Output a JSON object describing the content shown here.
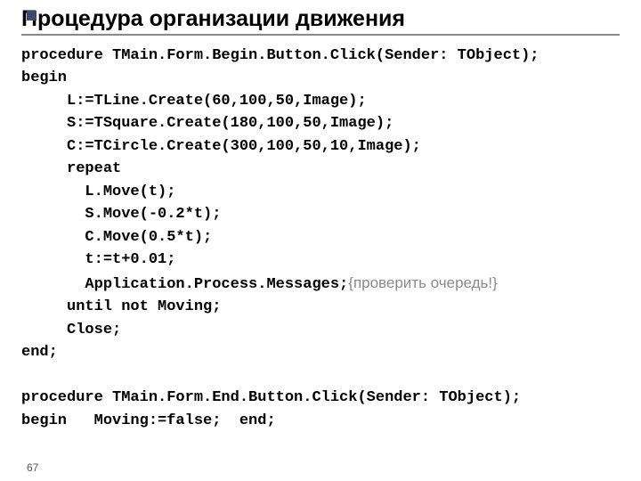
{
  "title": "Процедура организации движения",
  "code": {
    "l1": "procedure TMain.Form.Begin.Button.Click(Sender: TObject);",
    "l2": "begin",
    "l3": "     L:=TLine.Create(60,100,50,Image);",
    "l4": "     S:=TSquare.Create(180,100,50,Image);",
    "l5": "     C:=TCircle.Create(300,100,50,10,Image);",
    "l6": "     repeat",
    "l7": "       L.Move(t);",
    "l8": "       S.Move(-0.2*t);",
    "l9": "       C.Move(0.5*t);",
    "l10": "       t:=t+0.01;",
    "l11_a": "       Application.Process.Messages;",
    "l11_b": "{проверить очередь!}",
    "l12": "     until not Moving;",
    "l13": "     Close;",
    "l14": "end;",
    "l15": "",
    "l16": "procedure TMain.Form.End.Button.Click(Sender: TObject);",
    "l17": "begin   Moving:=false;  end;"
  },
  "pagenum": "67"
}
